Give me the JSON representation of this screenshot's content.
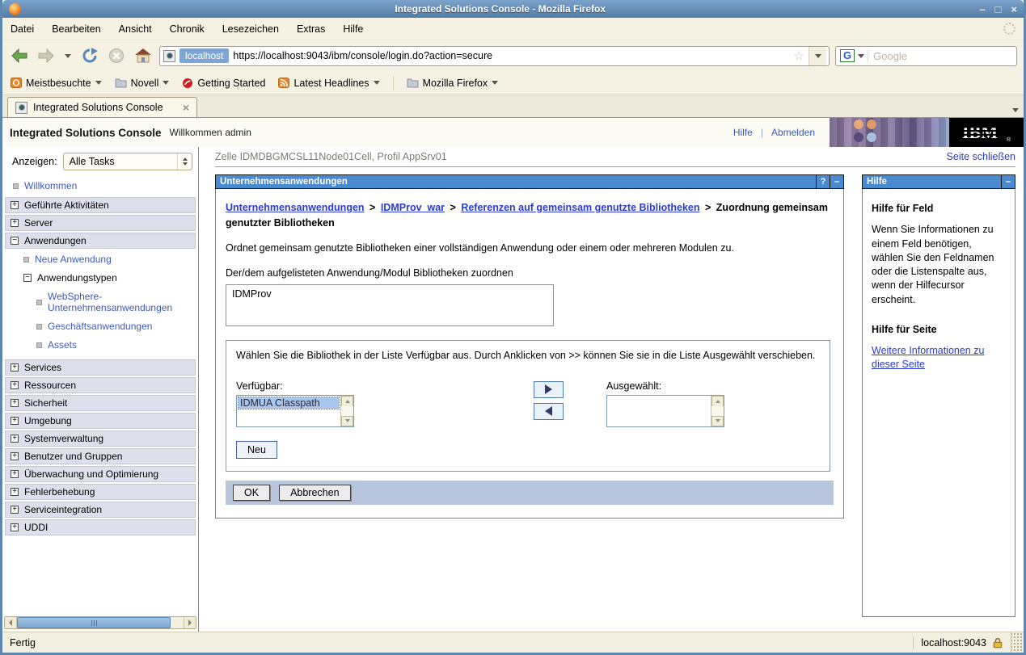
{
  "window": {
    "title": "Integrated Solutions Console - Mozilla Firefox"
  },
  "menubar": {
    "items": [
      "Datei",
      "Bearbeiten",
      "Ansicht",
      "Chronik",
      "Lesezeichen",
      "Extras",
      "Hilfe"
    ]
  },
  "navbar": {
    "site_badge": "localhost",
    "url": "https://localhost:9043/ibm/console/login.do?action=secure",
    "search_placeholder": "Google"
  },
  "bookmarks_bar": {
    "items": [
      {
        "label": "Meistbesuchte"
      },
      {
        "label": "Novell"
      },
      {
        "label": "Getting Started"
      },
      {
        "label": "Latest Headlines"
      },
      {
        "label": "Mozilla Firefox"
      }
    ]
  },
  "tabbar": {
    "active_tab": "Integrated Solutions Console"
  },
  "banner": {
    "title": "Integrated Solutions Console",
    "welcome": "Willkommen admin",
    "help_link": "Hilfe",
    "logout_link": "Abmelden",
    "logo_text": "IBM"
  },
  "sidebar": {
    "filter_label": "Anzeigen:",
    "filter_value": "Alle Tasks",
    "welcome_item": "Willkommen",
    "sections_top": [
      "Geführte Aktivitäten",
      "Server"
    ],
    "anwendungen": {
      "label": "Anwendungen",
      "neue_anwendung": "Neue Anwendung",
      "anwendungstypen": "Anwendungstypen",
      "typen": [
        "WebSphere-Unternehmensanwendungen",
        "Geschäftsanwendungen",
        "Assets"
      ]
    },
    "sections_bottom": [
      "Services",
      "Ressourcen",
      "Sicherheit",
      "Umgebung",
      "Systemverwaltung",
      "Benutzer und Gruppen",
      "Überwachung und Optimierung",
      "Fehlerbehebung",
      "Serviceintegration",
      "UDDI"
    ]
  },
  "main": {
    "context_line": "Zelle IDMDBGMCSL11Node01Cell, Profil AppSrv01",
    "close_page_link": "Seite schließen",
    "panel_title": "Unternehmensanwendungen",
    "breadcrumb": {
      "link1": "Unternehmensanwendungen",
      "link2": "IDMProv_war",
      "link3": "Referenzen auf gemeinsam genutzte Bibliotheken",
      "current": "Zuordnung gemeinsam genutzter Bibliotheken",
      "separator": ">"
    },
    "description": "Ordnet gemeinsam genutzte Bibliotheken einer vollständigen Anwendung oder einem oder mehreren Modulen zu.",
    "target_label": "Der/dem aufgelisteten Anwendung/Modul Bibliotheken zuordnen",
    "target_value": "IDMProv",
    "picker": {
      "instruction": "Wählen Sie die Bibliothek in der Liste Verfügbar aus. Durch Anklicken von >> können Sie sie in die Liste Ausgewählt verschieben.",
      "available_label": "Verfügbar:",
      "available_selected_item": "IDMUA Classpath",
      "selected_label": "Ausgewählt:",
      "new_button": "Neu"
    },
    "ok_button": "OK",
    "cancel_button": "Abbrechen"
  },
  "help_panel": {
    "title": "Hilfe",
    "field_help_heading": "Hilfe für Feld",
    "field_help_text": "Wenn Sie Informationen zu einem Feld benötigen, wählen Sie den Feldnamen oder die Listenspalte aus, wenn der Hilfecursor erscheint.",
    "page_help_heading": "Hilfe für Seite",
    "page_help_link": "Weitere Informationen zu dieser Seite"
  },
  "statusbar": {
    "status_text": "Fertig",
    "security_host": "localhost:9043"
  },
  "colors": {
    "titlebar_blue": "#6591bd",
    "panel_header_blue": "#4a8bd0",
    "toolbar_beige": "#f6f2e3",
    "section_header": "#dde0eb",
    "link_blue": "#3c5bbf",
    "selection_blue": "#a8c6ee",
    "action_bar": "#b7c6dd"
  }
}
